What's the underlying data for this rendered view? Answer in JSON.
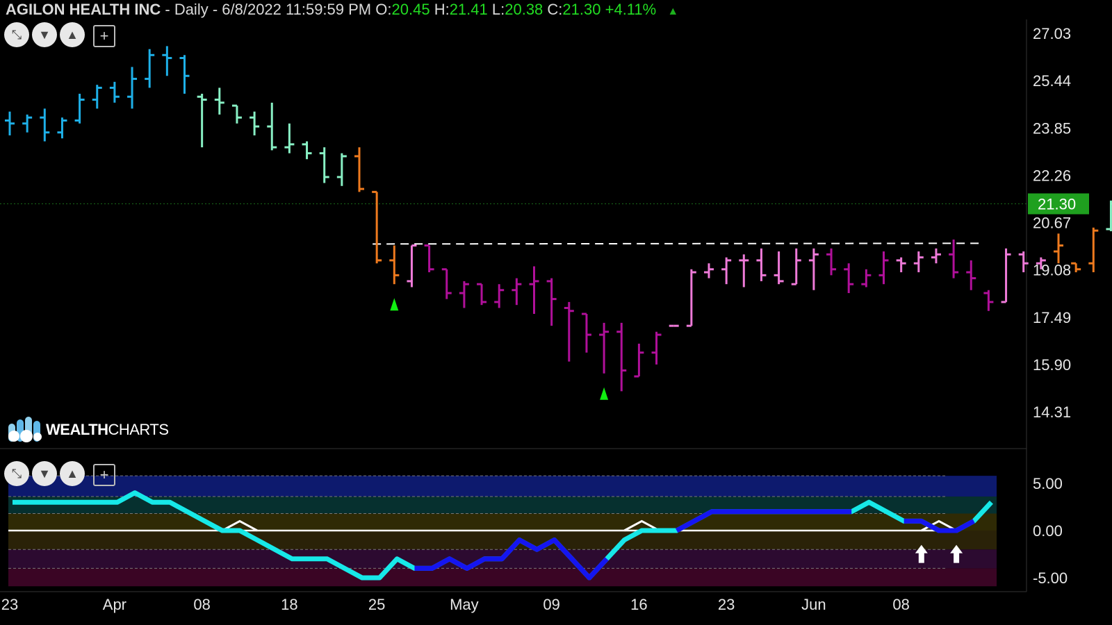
{
  "header": {
    "symbol": "AGILON HEALTH INC",
    "info": "- Daily - 6/8/2022 11:59:59 PM",
    "o_label": "O:",
    "o": "20.45",
    "h_label": "H:",
    "h": "21.41",
    "l_label": "L:",
    "l": "20.38",
    "c_label": "C:",
    "c": "21.30",
    "change": "+4.11%"
  },
  "brand": {
    "name_bold": "WEALTH",
    "name_rest": "CHARTS"
  },
  "colors": {
    "blue": "#1eb0e8",
    "mint": "#88f0c4",
    "orange": "#ee7a1e",
    "magenta": "#b0109a",
    "pink": "#ee7ad8",
    "green_signal": "#11ee11",
    "price_tag": "#1fa01f",
    "osc_cyan": "#17e8e8",
    "osc_blue": "#1515f0"
  },
  "chart_data": [
    {
      "type": "ohlc",
      "title": "AGILON HEALTH INC",
      "y_ticks": [
        "27.03",
        "25.44",
        "23.85",
        "22.26",
        "20.67",
        "19.08",
        "17.49",
        "15.90",
        "14.31"
      ],
      "ylim": [
        13.5,
        27.8
      ],
      "x_ticks": [
        {
          "i": 0,
          "label": "23"
        },
        {
          "i": 6,
          "label": "Apr"
        },
        {
          "i": 11,
          "label": "08"
        },
        {
          "i": 16,
          "label": "18"
        },
        {
          "i": 21,
          "label": "25"
        },
        {
          "i": 26,
          "label": "May"
        },
        {
          "i": 31,
          "label": "09"
        },
        {
          "i": 36,
          "label": "16"
        },
        {
          "i": 41,
          "label": "23"
        },
        {
          "i": 46,
          "label": "Jun"
        },
        {
          "i": 51,
          "label": "08"
        }
      ],
      "current_price": "21.30",
      "resistance_level": 19.95,
      "signal_up_indices": [
        22,
        34
      ],
      "bars": [
        {
          "o": 24.1,
          "h": 24.4,
          "l": 23.6,
          "c": 24.0,
          "col": "blue"
        },
        {
          "o": 24.0,
          "h": 24.3,
          "l": 23.7,
          "c": 24.2,
          "col": "blue"
        },
        {
          "o": 24.2,
          "h": 24.5,
          "l": 23.4,
          "c": 23.7,
          "col": "blue"
        },
        {
          "o": 23.7,
          "h": 24.2,
          "l": 23.5,
          "c": 24.1,
          "col": "blue"
        },
        {
          "o": 24.1,
          "h": 25.0,
          "l": 24.0,
          "c": 24.8,
          "col": "blue"
        },
        {
          "o": 24.8,
          "h": 25.3,
          "l": 24.5,
          "c": 25.2,
          "col": "blue"
        },
        {
          "o": 25.2,
          "h": 25.4,
          "l": 24.7,
          "c": 24.9,
          "col": "blue"
        },
        {
          "o": 24.9,
          "h": 25.9,
          "l": 24.5,
          "c": 25.5,
          "col": "blue"
        },
        {
          "o": 25.5,
          "h": 26.5,
          "l": 25.2,
          "c": 26.3,
          "col": "blue"
        },
        {
          "o": 26.3,
          "h": 26.6,
          "l": 25.6,
          "c": 26.2,
          "col": "blue"
        },
        {
          "o": 26.2,
          "h": 26.3,
          "l": 25.0,
          "c": 25.6,
          "col": "blue"
        },
        {
          "o": 24.9,
          "h": 25.0,
          "l": 23.2,
          "c": 24.8,
          "col": "mint"
        },
        {
          "o": 24.8,
          "h": 25.2,
          "l": 24.3,
          "c": 24.7,
          "col": "mint"
        },
        {
          "o": 24.6,
          "h": 24.6,
          "l": 24.0,
          "c": 24.2,
          "col": "mint"
        },
        {
          "o": 24.2,
          "h": 24.4,
          "l": 23.6,
          "c": 23.9,
          "col": "mint"
        },
        {
          "o": 23.9,
          "h": 24.7,
          "l": 23.1,
          "c": 23.2,
          "col": "mint"
        },
        {
          "o": 23.2,
          "h": 24.0,
          "l": 23.0,
          "c": 23.3,
          "col": "mint"
        },
        {
          "o": 23.3,
          "h": 23.4,
          "l": 22.8,
          "c": 23.0,
          "col": "mint"
        },
        {
          "o": 23.0,
          "h": 23.2,
          "l": 22.0,
          "c": 22.2,
          "col": "mint"
        },
        {
          "o": 22.2,
          "h": 23.0,
          "l": 21.9,
          "c": 22.9,
          "col": "mint"
        },
        {
          "o": 22.9,
          "h": 23.2,
          "l": 21.7,
          "c": 21.8,
          "col": "orange"
        },
        {
          "o": 21.7,
          "h": 21.7,
          "l": 19.3,
          "c": 19.4,
          "col": "orange"
        },
        {
          "o": 19.4,
          "h": 19.9,
          "l": 18.6,
          "c": 18.9,
          "col": "orange"
        },
        {
          "o": 18.7,
          "h": 19.9,
          "l": 18.5,
          "c": 19.9,
          "col": "pink"
        },
        {
          "o": 19.9,
          "h": 19.9,
          "l": 19.0,
          "c": 19.1,
          "col": "magenta"
        },
        {
          "o": 19.1,
          "h": 19.1,
          "l": 18.1,
          "c": 18.3,
          "col": "magenta"
        },
        {
          "o": 18.3,
          "h": 18.7,
          "l": 17.8,
          "c": 18.6,
          "col": "magenta"
        },
        {
          "o": 18.6,
          "h": 18.6,
          "l": 17.9,
          "c": 18.0,
          "col": "magenta"
        },
        {
          "o": 18.0,
          "h": 18.6,
          "l": 17.8,
          "c": 18.4,
          "col": "magenta"
        },
        {
          "o": 18.4,
          "h": 18.8,
          "l": 17.9,
          "c": 18.6,
          "col": "magenta"
        },
        {
          "o": 18.6,
          "h": 19.2,
          "l": 17.6,
          "c": 18.7,
          "col": "magenta"
        },
        {
          "o": 18.7,
          "h": 18.8,
          "l": 17.2,
          "c": 18.1,
          "col": "magenta"
        },
        {
          "o": 17.8,
          "h": 18.0,
          "l": 16.0,
          "c": 17.7,
          "col": "magenta"
        },
        {
          "o": 17.6,
          "h": 17.6,
          "l": 16.3,
          "c": 16.9,
          "col": "magenta"
        },
        {
          "o": 16.9,
          "h": 17.3,
          "l": 15.6,
          "c": 17.0,
          "col": "magenta"
        },
        {
          "o": 17.0,
          "h": 17.3,
          "l": 15.0,
          "c": 15.7,
          "col": "magenta"
        },
        {
          "o": 15.5,
          "h": 16.6,
          "l": 15.5,
          "c": 16.3,
          "col": "magenta"
        },
        {
          "o": 16.3,
          "h": 17.0,
          "l": 15.9,
          "c": 16.9,
          "col": "magenta"
        },
        {
          "o": 17.2,
          "h": 17.2,
          "l": 17.2,
          "c": 17.2,
          "col": "pink"
        },
        {
          "o": 17.2,
          "h": 19.1,
          "l": 17.2,
          "c": 19.0,
          "col": "pink"
        },
        {
          "o": 19.0,
          "h": 19.3,
          "l": 18.8,
          "c": 19.1,
          "col": "pink"
        },
        {
          "o": 19.1,
          "h": 19.5,
          "l": 18.6,
          "c": 19.4,
          "col": "pink"
        },
        {
          "o": 19.4,
          "h": 19.6,
          "l": 18.5,
          "c": 19.4,
          "col": "pink"
        },
        {
          "o": 19.4,
          "h": 19.8,
          "l": 18.7,
          "c": 18.9,
          "col": "pink"
        },
        {
          "o": 18.9,
          "h": 19.7,
          "l": 18.6,
          "c": 18.7,
          "col": "pink"
        },
        {
          "o": 18.6,
          "h": 19.8,
          "l": 18.6,
          "c": 19.4,
          "col": "pink"
        },
        {
          "o": 19.4,
          "h": 19.8,
          "l": 18.4,
          "c": 19.6,
          "col": "pink"
        },
        {
          "o": 19.6,
          "h": 19.8,
          "l": 18.9,
          "c": 19.1,
          "col": "magenta"
        },
        {
          "o": 19.1,
          "h": 19.3,
          "l": 18.3,
          "c": 18.6,
          "col": "magenta"
        },
        {
          "o": 18.6,
          "h": 19.1,
          "l": 18.5,
          "c": 18.9,
          "col": "magenta"
        },
        {
          "o": 18.9,
          "h": 19.7,
          "l": 18.6,
          "c": 19.4,
          "col": "magenta"
        },
        {
          "o": 19.4,
          "h": 19.5,
          "l": 19.0,
          "c": 19.3,
          "col": "pink"
        },
        {
          "o": 19.3,
          "h": 19.7,
          "l": 19.0,
          "c": 19.5,
          "col": "pink"
        },
        {
          "o": 19.5,
          "h": 19.8,
          "l": 19.3,
          "c": 19.6,
          "col": "pink"
        },
        {
          "o": 19.6,
          "h": 20.1,
          "l": 18.8,
          "c": 19.0,
          "col": "magenta"
        },
        {
          "o": 19.0,
          "h": 19.4,
          "l": 18.4,
          "c": 18.8,
          "col": "magenta"
        },
        {
          "o": 18.3,
          "h": 18.4,
          "l": 17.7,
          "c": 18.0,
          "col": "magenta"
        },
        {
          "o": 18.0,
          "h": 19.8,
          "l": 18.0,
          "c": 19.6,
          "col": "pink"
        },
        {
          "o": 19.6,
          "h": 19.7,
          "l": 19.0,
          "c": 19.3,
          "col": "pink"
        },
        {
          "o": 19.3,
          "h": 19.5,
          "l": 19.1,
          "c": 19.4,
          "col": "pink"
        },
        {
          "o": 19.7,
          "h": 20.3,
          "l": 19.3,
          "c": 19.9,
          "col": "orange"
        },
        {
          "o": 19.3,
          "h": 19.3,
          "l": 19.0,
          "c": 19.1,
          "col": "orange"
        },
        {
          "o": 19.3,
          "h": 20.5,
          "l": 19.0,
          "c": 20.4,
          "col": "orange"
        },
        {
          "o": 20.45,
          "h": 21.41,
          "l": 20.38,
          "c": 21.3,
          "col": "mint"
        }
      ]
    },
    {
      "type": "line",
      "title": "",
      "y_ticks": [
        "5.00",
        "0.00",
        "-5.00"
      ],
      "ylim": [
        -6.3,
        6.3
      ],
      "values": [
        3,
        3,
        3,
        3,
        3,
        3,
        3,
        4,
        3,
        3,
        2,
        1,
        0,
        0,
        -1,
        -2,
        -3,
        -3,
        -3,
        -4,
        -5,
        -5,
        -3,
        -4,
        -4,
        -3,
        -4,
        -3,
        -3,
        -1,
        -2,
        -1,
        -3,
        -5,
        -3,
        -1,
        0,
        0,
        0,
        1,
        2,
        2,
        2,
        2,
        2,
        2,
        2,
        2,
        2,
        3,
        2,
        1,
        1,
        0,
        0,
        1,
        3
      ],
      "signal_values": [
        null,
        null,
        null,
        null,
        null,
        null,
        null,
        null,
        null,
        null,
        null,
        null,
        0,
        1,
        0,
        null,
        null,
        null,
        null,
        null,
        null,
        null,
        null,
        null,
        null,
        null,
        null,
        null,
        null,
        null,
        null,
        null,
        null,
        null,
        null,
        0,
        1,
        0,
        null,
        null,
        null,
        null,
        null,
        null,
        null,
        null,
        null,
        null,
        null,
        null,
        null,
        null,
        0,
        1,
        0,
        null,
        null
      ],
      "blue_segments": [
        [
          23,
          34
        ],
        [
          38,
          48
        ],
        [
          51,
          55
        ]
      ],
      "arrow_indices": [
        52,
        54
      ]
    }
  ]
}
